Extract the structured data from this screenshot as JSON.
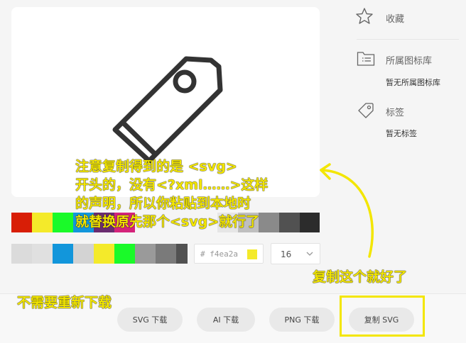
{
  "sidebar": {
    "favorite_label": "收藏",
    "library_label": "所属图标库",
    "library_value": "暂无所属图标库",
    "tags_label": "标签",
    "tags_value": "暂无标签"
  },
  "editor": {
    "color_value": "# f4ea2a",
    "accent_color": "#f4ea2a",
    "size_value": "16"
  },
  "actions": {
    "svg_download": "SVG 下载",
    "ai_download": "AI 下载",
    "png_download": "PNG 下载",
    "copy_svg": "复制 SVG"
  },
  "annotations": {
    "callout_line1": "注意复制得到的是 <svg>",
    "callout_line2": "开头的，没有<?xml……>这样",
    "callout_line3": "的声明，所以你粘贴到本地时",
    "callout_line4": "就替换原先那个<svg>就行了",
    "copy_note": "复制这个就好了",
    "redownload_note": "不需要重新下载"
  }
}
